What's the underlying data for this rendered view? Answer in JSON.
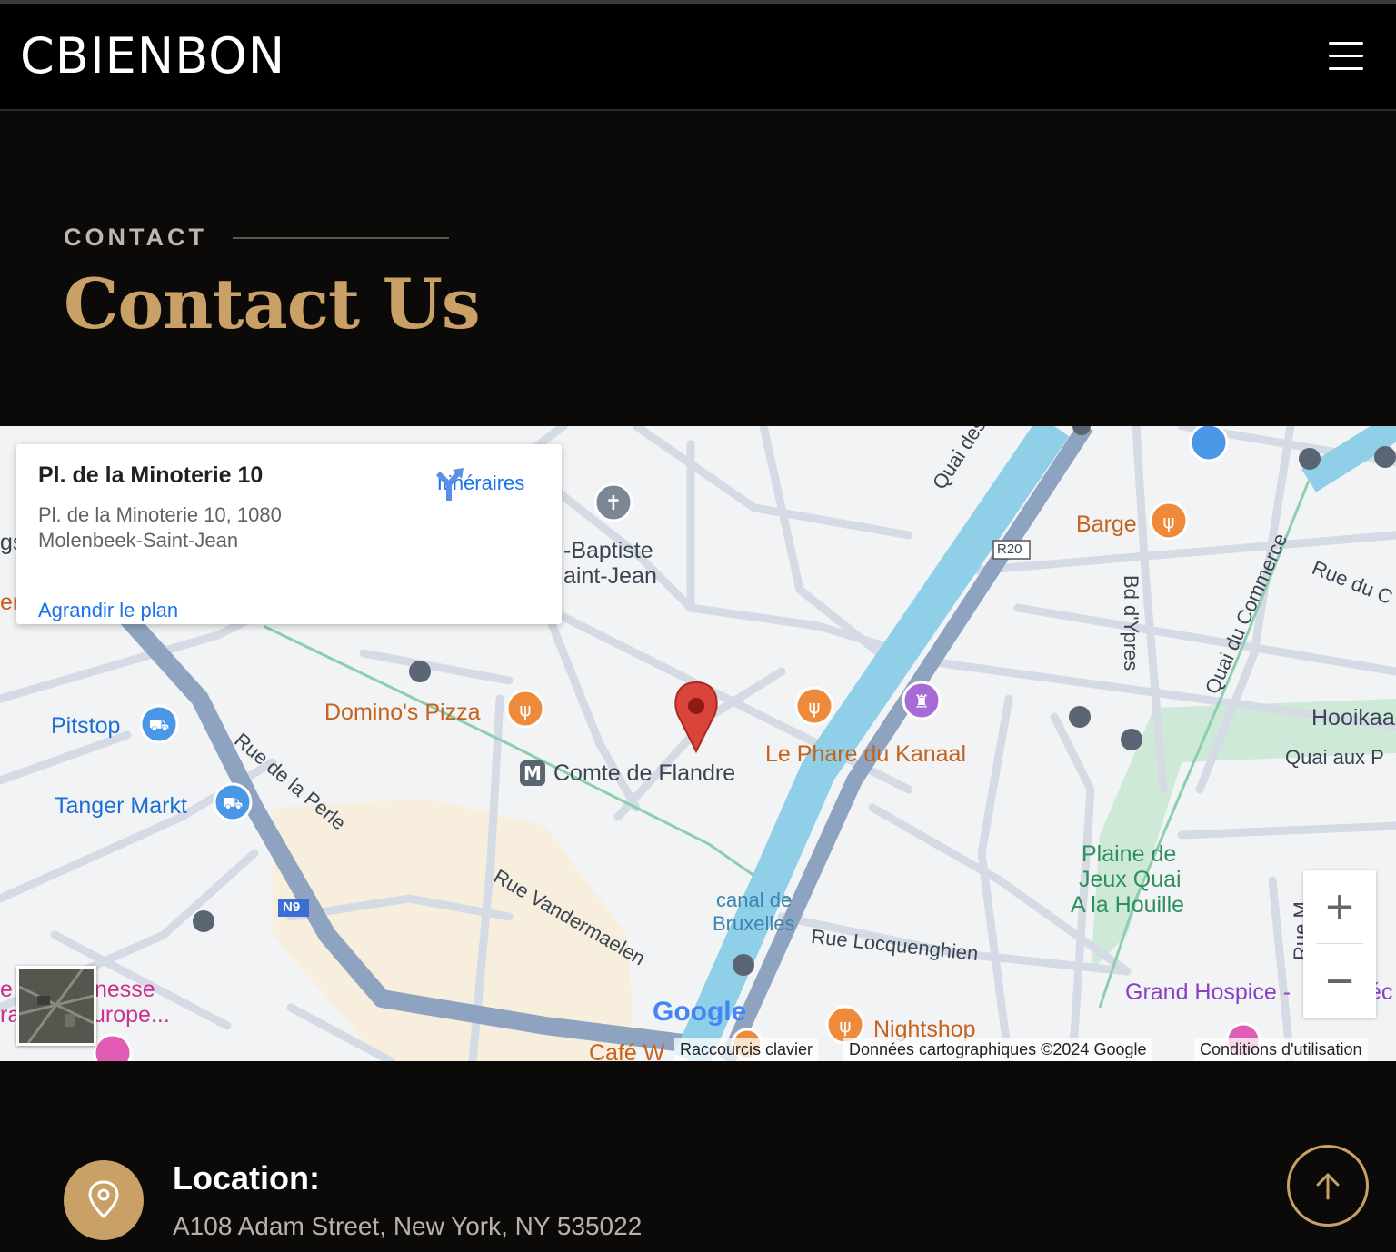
{
  "header": {
    "logo": "CBIENBON",
    "menu_icon": "hamburger-menu-icon"
  },
  "hero": {
    "eyebrow": "CONTACT",
    "title": "Contact Us"
  },
  "map": {
    "info_card": {
      "title": "Pl. de la Minoterie 10",
      "address_line1": "Pl. de la Minoterie 10, 1080",
      "address_line2": "Molenbeek-Saint-Jean",
      "directions_label": "Itinéraires",
      "enlarge_link": "Agrandir le plan"
    },
    "labels": {
      "pitstop": "Pitstop",
      "tanger": "Tanger Markt",
      "dominos": "Domino's Pizza",
      "comte": "Comte de Flandre",
      "phare": "Le Phare du Kanaal",
      "barge": "Barge",
      "baptiste1": "-Baptiste",
      "baptiste2": "aint-Jean",
      "quai_charbonnages": "Quai des Char",
      "r20": "R20",
      "bd_ypres": "Bd d'Ypres",
      "quai_commerce": "Quai du Commerce",
      "rue_du": "Rue du C",
      "hooikaai": "Hooikaa",
      "quai_aux": "Quai aux P",
      "plaine1": "Plaine de",
      "plaine2": "Jeux Quai",
      "plaine3": "A la Houille",
      "rue_perle": "Rue de la Perle",
      "rue_vandermaelen": "Rue Vandermaelen",
      "canal1": "canal de",
      "canal2": "Bruxelles",
      "rue_locquenghien": "Rue Locquenghien",
      "n9": "N9",
      "grand_hospice": "Grand Hospice -",
      "nightshop": "Nightshop",
      "cafe": "Café W",
      "jeunesse1": "nesse",
      "jeunesse2": "urope...",
      "edge_gs": "gs",
      "edge_e": "e",
      "edge_ra": "ra",
      "edge_er": "er",
      "rue_m": "Rue M",
      "ec": "éc"
    },
    "zoom_in": "+",
    "zoom_out": "−",
    "attribution": {
      "shortcuts": "Raccourcis clavier",
      "data": "Données cartographiques ©2024 Google",
      "terms": "Conditions d'utilisation"
    },
    "google_logo": "Google"
  },
  "location": {
    "title": "Location:",
    "address": "A108 Adam Street, New York, NY 535022"
  },
  "colors": {
    "accent": "#c9a065",
    "background": "#0b0a09",
    "nav": "#000000"
  }
}
